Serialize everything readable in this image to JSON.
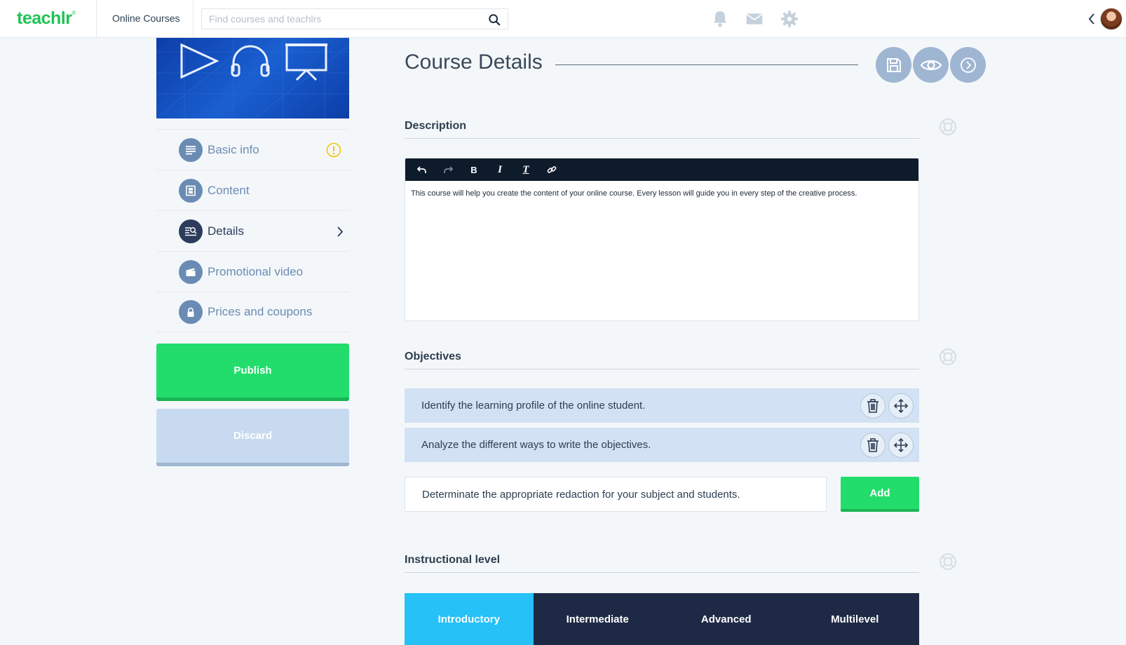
{
  "header": {
    "logo": "teachlr",
    "logo_mark": "®",
    "nav_label": "Online Courses",
    "search_placeholder": "Find courses and teachlrs"
  },
  "sidebar": {
    "items": [
      {
        "label": "Basic info",
        "icon": "list-icon"
      },
      {
        "label": "Content",
        "icon": "film-icon"
      },
      {
        "label": "Details",
        "icon": "details-search-icon"
      },
      {
        "label": "Promotional video",
        "icon": "clapper-icon"
      },
      {
        "label": "Prices and coupons",
        "icon": "lock-icon"
      }
    ],
    "active_item": "Details",
    "publish_label": "Publish",
    "discard_label": "Discard"
  },
  "main": {
    "title": "Course Details",
    "description": {
      "heading": "Description",
      "body": "This course will help you create the content of your online course. Every lesson will guide you in every step of the creative process."
    },
    "objectives": {
      "heading": "Objectives",
      "items": [
        "Identify the learning profile of the online student.",
        "Analyze the different ways to write the objectives."
      ],
      "input_value": "Determinate the appropriate redaction for your subject and students.",
      "add_label": "Add"
    },
    "level": {
      "heading": "Instructional level",
      "options": [
        "Introductory",
        "Intermediate",
        "Advanced",
        "Multilevel"
      ],
      "selected": "Introductory"
    }
  },
  "colors": {
    "brand_green": "#1fc454",
    "publish_green": "#22dd6b",
    "accent_blue": "#25c1f7",
    "sidebar_icon": "#6a8cb4",
    "dark_navy": "#1e2a45",
    "warning": "#f5c400"
  }
}
